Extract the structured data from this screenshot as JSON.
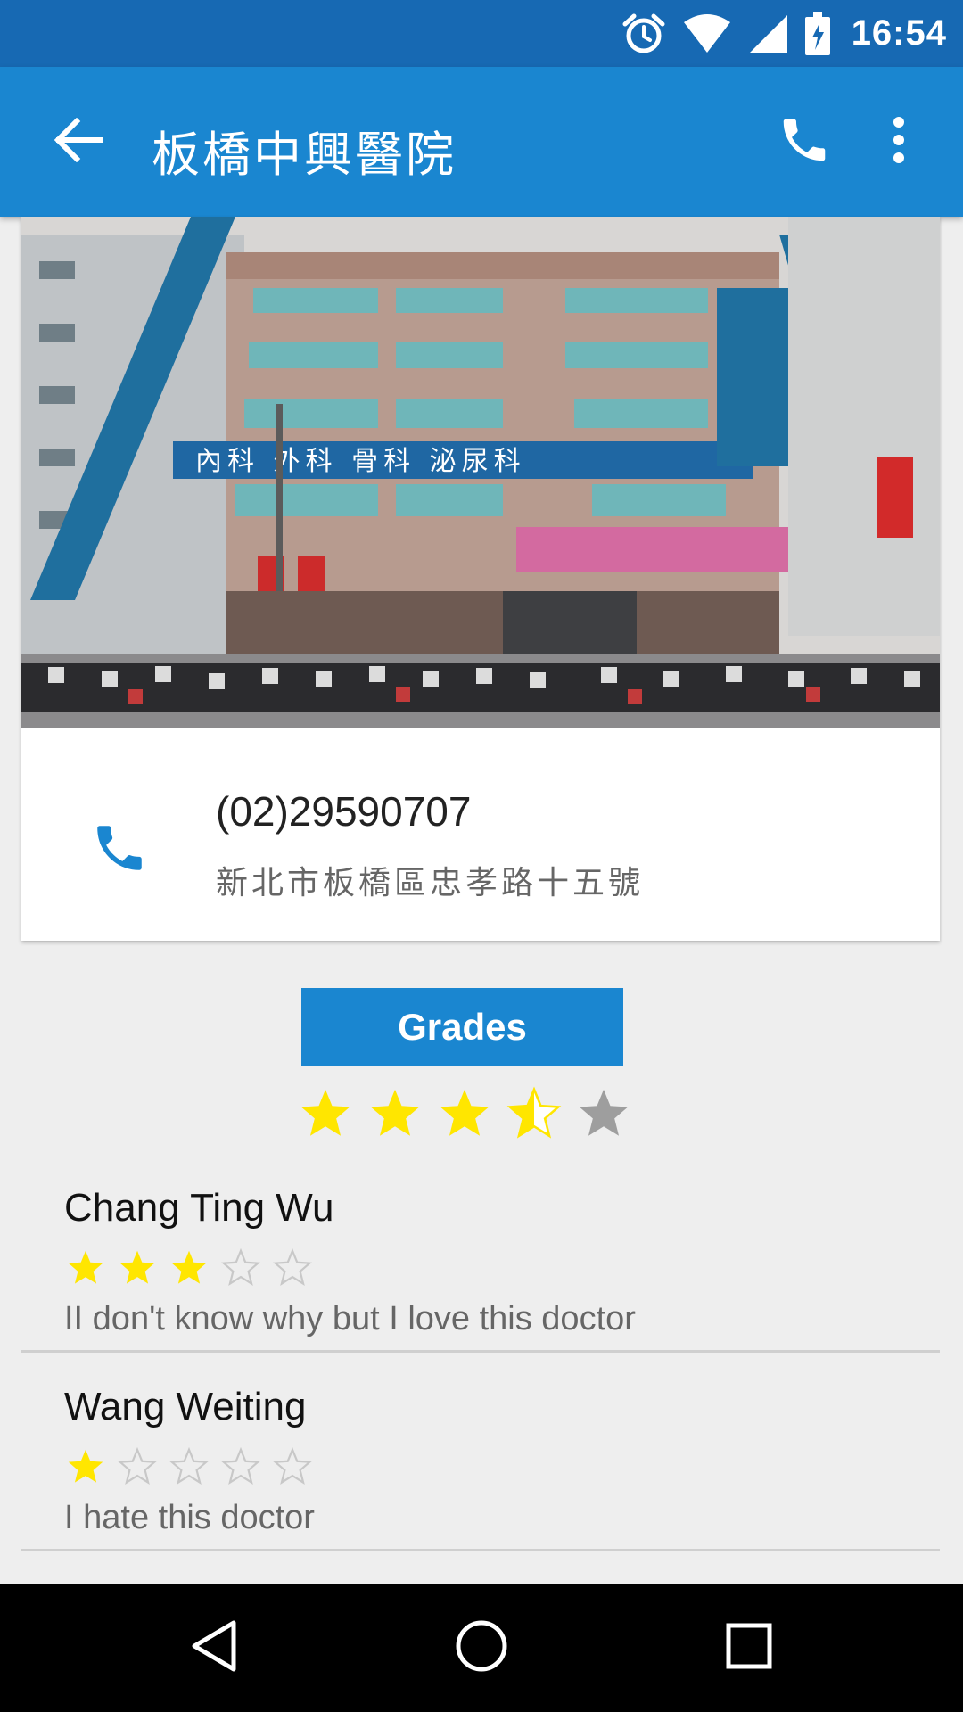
{
  "status_bar": {
    "time": "16:54",
    "icons": [
      "alarm-icon",
      "wifi-icon",
      "signal-icon",
      "battery-charging-icon"
    ]
  },
  "app_bar": {
    "title": "板橋中興醫院",
    "back_icon": "arrow-back-icon",
    "call_icon": "phone-icon",
    "more_icon": "more-vertical-icon"
  },
  "hospital": {
    "phone": "(02)29590707",
    "address": "新北市板橋區忠孝路十五號",
    "photo_signs": {
      "banner": "內科 外科 骨科 泌尿科"
    }
  },
  "grades": {
    "button_label": "Grades",
    "overall_rating": 3.5,
    "max_rating": 5
  },
  "reviews": [
    {
      "name": "Chang Ting Wu",
      "rating": 3,
      "comment": "II don't know why but I love this doctor"
    },
    {
      "name": "Wang Weiting",
      "rating": 1,
      "comment": "I hate this doctor"
    }
  ],
  "colors": {
    "status_bar": "#1769b3",
    "app_bar": "#1a86d0",
    "accent": "#1a86d0",
    "star_filled": "#ffe600",
    "star_empty_overall": "#9e9e9e",
    "star_outline": "#c8c8c8"
  },
  "nav_bar": {
    "buttons": [
      "back-triangle-icon",
      "home-circle-icon",
      "recents-square-icon"
    ]
  }
}
